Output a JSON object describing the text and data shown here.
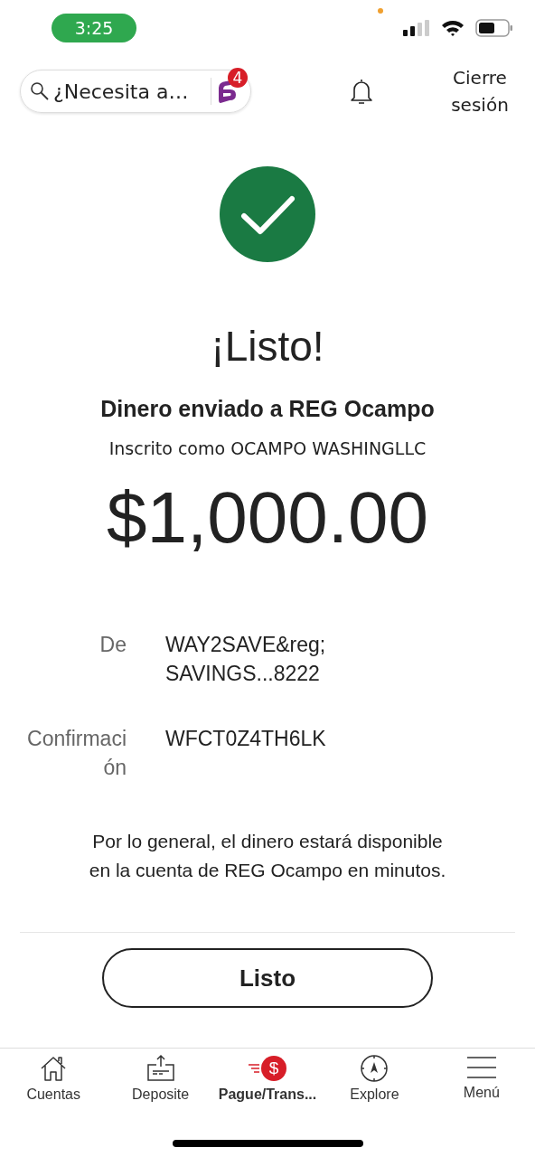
{
  "status_bar": {
    "time": "3:25"
  },
  "header": {
    "search": {
      "placeholder": "¿Necesita a…"
    },
    "chat_badge": "4",
    "logout": "Cierre sesión"
  },
  "confirmation": {
    "title": "¡Listo!",
    "headline": "Dinero enviado a REG Ocampo",
    "subtitle": "Inscrito como OCAMPO WASHINGLLC",
    "amount": "$1,000.00",
    "details": [
      {
        "label": "De",
        "value": "WAY2SAVE&reg; SAVINGS...8222"
      },
      {
        "label": "Confirmación",
        "value": "WFCT0Z4TH6LK"
      }
    ],
    "message": "Por lo general, el dinero estará disponible en la cuenta de REG Ocampo en minutos.",
    "button": "Listo"
  },
  "tabs": [
    {
      "kind": "home",
      "label": "Cuentas",
      "selected": false
    },
    {
      "kind": "deposit",
      "label": "Deposite",
      "selected": false
    },
    {
      "kind": "pay",
      "label": "Pague/Trans...",
      "glyph": "$",
      "selected": true
    },
    {
      "kind": "explore",
      "label": "Explore",
      "selected": false
    },
    {
      "kind": "menu",
      "label": "Menú",
      "selected": false
    }
  ]
}
